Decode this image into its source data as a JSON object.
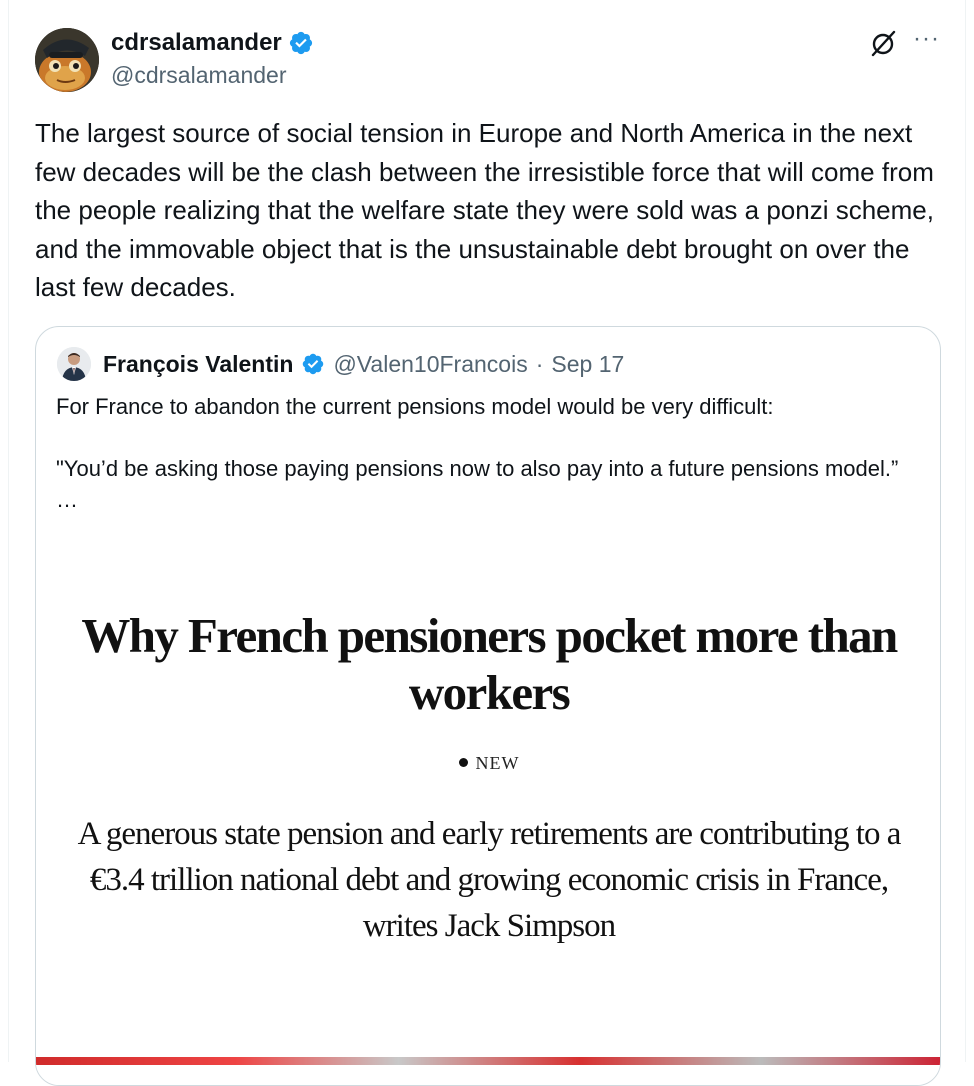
{
  "post": {
    "author_name": "cdrsalamander",
    "author_handle": "@cdrsalamander",
    "text": "The largest source of social tension in Europe and North America in the next few decades will be the clash between the irresistible force that will come from the people realizing that the welfare state they were sold was a ponzi scheme, and the immovable object that is the unsustainable debt brought on over the last few decades.",
    "icons": {
      "verified": "verified-badge-icon",
      "grok": "grok-icon",
      "more": "more-options-icon"
    },
    "more_glyph": "···"
  },
  "quote": {
    "author_name": "François Valentin",
    "author_handle": "@Valen10Francois",
    "separator": "·",
    "date": "Sep 17",
    "line1": "For France to abandon the current pensions model would be very difficult:",
    "line2": "\"You’d be asking those paying pensions now to also pay into a future pensions model.”",
    "ellipsis": "…"
  },
  "article": {
    "headline": "Why French pensioners pocket more than workers",
    "badge": "NEW",
    "standfirst": "A generous state pension and early retirements are contributing to a €3.4 trillion national debt and growing economic crisis in France, writes Jack Simpson"
  },
  "colors": {
    "verified_blue": "#1d9bf0",
    "secondary_text": "#536471",
    "border": "#cfd9de"
  }
}
